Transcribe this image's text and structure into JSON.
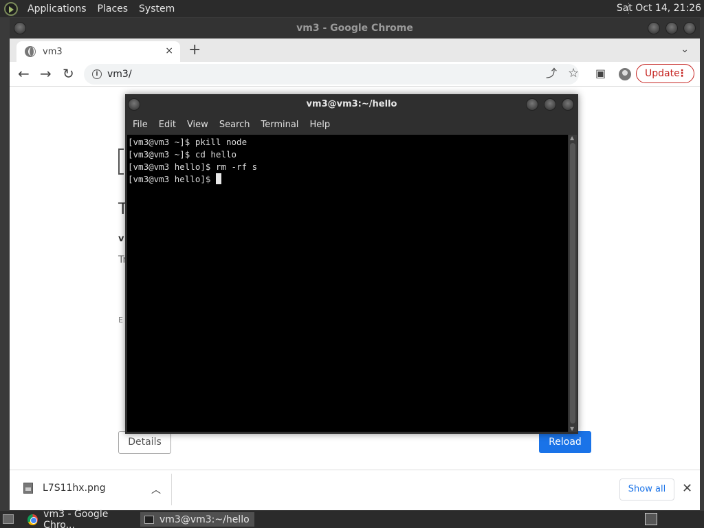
{
  "top_panel": {
    "menus": [
      "Applications",
      "Places",
      "System"
    ],
    "clock": "Sat Oct 14, 21:26"
  },
  "chrome": {
    "window_title": "vm3 - Google Chrome",
    "tab_title": "vm3",
    "tab_close": "×",
    "new_tab": "+",
    "tab_search": "⌄",
    "url": "vm3/",
    "update_label": "Update",
    "update_menu": "⋮"
  },
  "page": {
    "details_label": "Details",
    "reload_label": "Reload",
    "fragment_heading": "T",
    "fragment_bold": "v",
    "fragment_text": "Tr",
    "fragment_small": "E"
  },
  "download_shelf": {
    "filename": "L7S11hx.png",
    "show_all_label": "Show all",
    "close": "✕"
  },
  "terminal": {
    "title": "vm3@vm3:~/hello",
    "menus": [
      "File",
      "Edit",
      "View",
      "Search",
      "Terminal",
      "Help"
    ],
    "lines": [
      "[vm3@vm3 ~]$ pkill node",
      "[vm3@vm3 ~]$ cd hello",
      "[vm3@vm3 hello]$ rm -rf s"
    ],
    "prompt": "[vm3@vm3 hello]$ "
  },
  "taskbar": {
    "items": [
      "vm3 - Google Chro...",
      "vm3@vm3:~/hello"
    ]
  },
  "icons": {
    "back": "←",
    "forward": "→",
    "reload": "↻",
    "share": "⤴",
    "star": "☆",
    "sidepanel": "▣"
  }
}
